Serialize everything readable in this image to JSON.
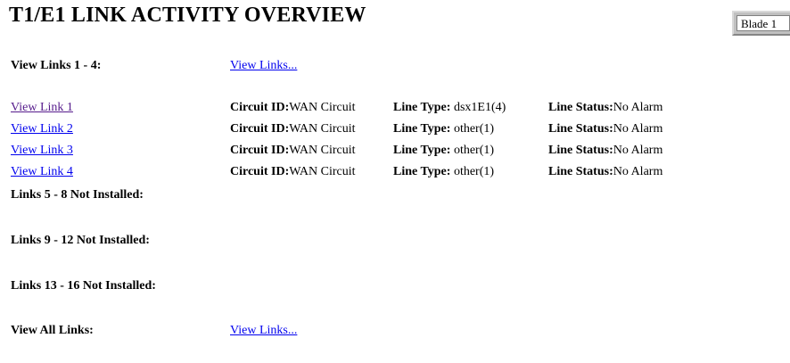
{
  "page": {
    "title": "T1/E1 LINK ACTIVITY OVERVIEW",
    "blade_select": {
      "selected": "Blade 1"
    }
  },
  "view_links_group": {
    "label": "View Links 1 - 4:",
    "link_text": "View Links..."
  },
  "links": [
    {
      "name": "View Link 1",
      "circuit_label": "Circuit ID:",
      "circuit_value": "WAN Circuit",
      "type_label": "Line Type:",
      "type_value": "dsx1E1(4)",
      "status_label": "Line Status:",
      "status_value": "No Alarm"
    },
    {
      "name": "View Link 2",
      "circuit_label": "Circuit ID:",
      "circuit_value": "WAN Circuit",
      "type_label": "Line Type:",
      "type_value": "other(1)",
      "status_label": "Line Status:",
      "status_value": "No Alarm"
    },
    {
      "name": "View Link 3",
      "circuit_label": "Circuit ID:",
      "circuit_value": "WAN Circuit",
      "type_label": "Line Type:",
      "type_value": "other(1)",
      "status_label": "Line Status:",
      "status_value": "No Alarm"
    },
    {
      "name": "View Link 4",
      "circuit_label": "Circuit ID:",
      "circuit_value": "WAN Circuit",
      "type_label": "Line Type:",
      "type_value": "other(1)",
      "status_label": "Line Status:",
      "status_value": "No Alarm"
    }
  ],
  "not_installed": [
    "Links 5 - 8 Not Installed:",
    "Links 9 - 12 Not Installed:",
    "Links 13 - 16 Not Installed:"
  ],
  "view_all": {
    "label": "View All Links:",
    "link_text": "View Links..."
  }
}
